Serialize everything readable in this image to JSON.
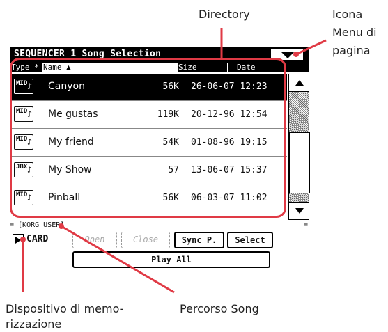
{
  "callouts": {
    "directory": "Directory",
    "menu_icon": [
      "Icona",
      "Menu di",
      "pagina"
    ],
    "storage_device": [
      "Dispositivo di memo-",
      "rizzazione"
    ],
    "song_path": "Percorso Song"
  },
  "window": {
    "title": "SEQUENCER 1  Song Selection",
    "menu_icon": "triangle-down-icon"
  },
  "columns": {
    "type": "Type *",
    "name": "Name ▲",
    "size": "Size",
    "date": "Date"
  },
  "files": [
    {
      "type": "MID",
      "name": "Canyon",
      "size": "56K",
      "date": "26-06-07 12:23",
      "selected": true
    },
    {
      "type": "MID",
      "name": "Me gustas",
      "size": "119K",
      "date": "20-12-96 12:54",
      "selected": false
    },
    {
      "type": "MID",
      "name": "My friend",
      "size": "54K",
      "date": "01-08-96 19:15",
      "selected": false
    },
    {
      "type": "JBX",
      "name": "My Show",
      "size": "57",
      "date": "13-06-07 15:37",
      "selected": false
    },
    {
      "type": "MID",
      "name": "Pinball",
      "size": "56K",
      "date": "06-03-07 11:02",
      "selected": false
    }
  ],
  "path": "≡ [KORG USER]",
  "path_menu": "≡",
  "device": {
    "label": "CARD"
  },
  "buttons": {
    "open": "Open",
    "close": "Close",
    "sync": "Sync P.",
    "select": "Select",
    "play_all": "Play All"
  },
  "colors": {
    "callout_line": "#e03a45",
    "selected_row": "#000000"
  }
}
